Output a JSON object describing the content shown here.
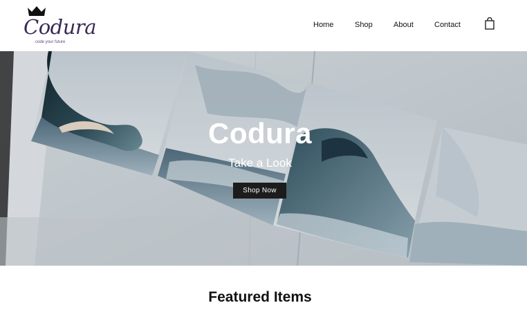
{
  "brand": {
    "name": "Codura",
    "tagline": "code your future",
    "icon": "crown-icon",
    "color": "#3a2a55"
  },
  "nav": {
    "items": [
      {
        "label": "Home"
      },
      {
        "label": "Shop"
      },
      {
        "label": "About"
      },
      {
        "label": "Contact"
      }
    ],
    "cart_icon": "shopping-bag-icon"
  },
  "hero": {
    "title": "Codura",
    "subtitle": "Take a Look",
    "button_label": "Shop Now",
    "button_color": "#1c1c1c"
  },
  "sections": {
    "featured_title": "Featured Items"
  }
}
